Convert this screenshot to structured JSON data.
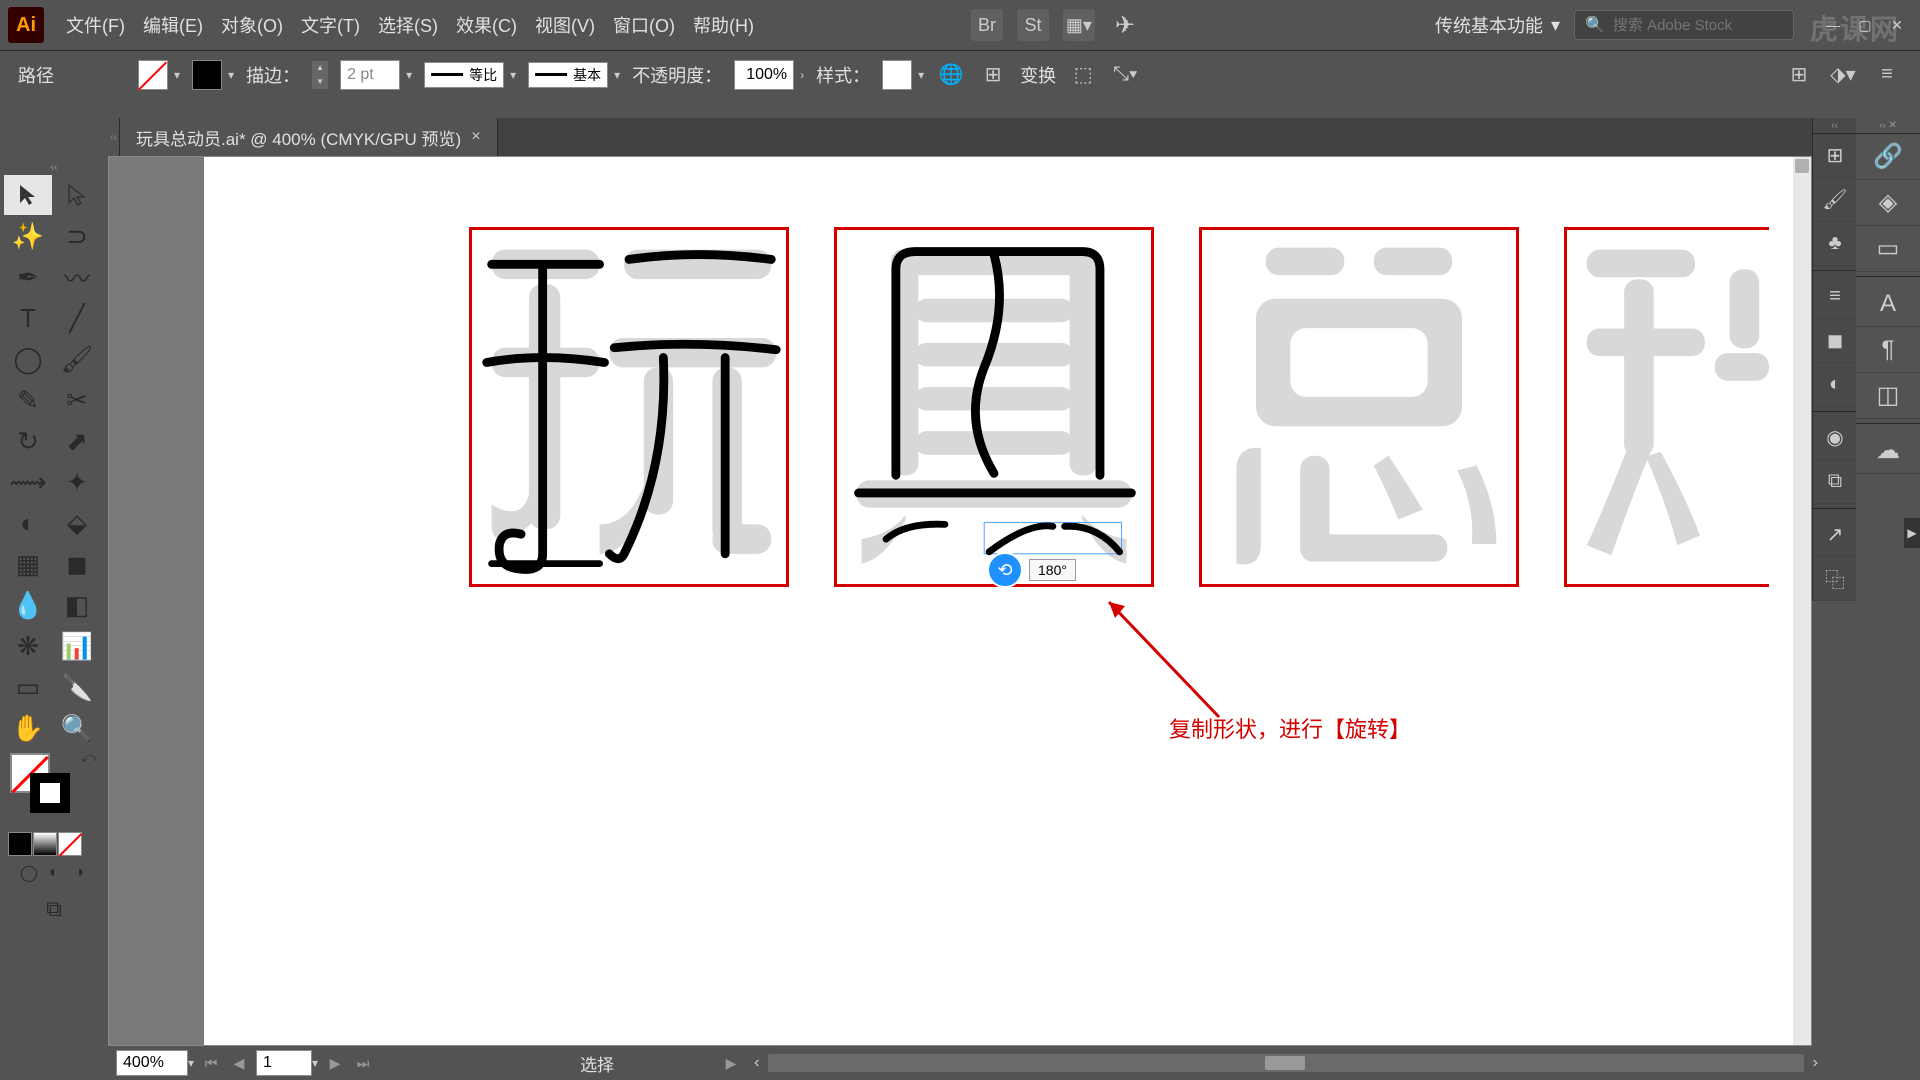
{
  "app": {
    "logo": "Ai"
  },
  "menu": {
    "file": "文件(F)",
    "edit": "编辑(E)",
    "object": "对象(O)",
    "type": "文字(T)",
    "select": "选择(S)",
    "effect": "效果(C)",
    "view": "视图(V)",
    "window": "窗口(O)",
    "help": "帮助(H)"
  },
  "workspace": {
    "label": "传统基本功能"
  },
  "search": {
    "placeholder": "搜索 Adobe Stock"
  },
  "control": {
    "selection_label": "路径",
    "stroke_label": "描边：",
    "stroke_value": "2 pt",
    "profile_label": "等比",
    "brush_label": "基本",
    "opacity_label": "不透明度：",
    "opacity_value": "100%",
    "style_label": "样式：",
    "transform_label": "变换"
  },
  "tab": {
    "name": "玩具总动员.ai* @ 400% (CMYK/GPU 预览)"
  },
  "canvas": {
    "rotate_tip": "180°",
    "annotation": "复制形状，进行【旋转】"
  },
  "status": {
    "zoom": "400%",
    "artboard": "1",
    "tool": "选择"
  },
  "watermark": "虎课网"
}
